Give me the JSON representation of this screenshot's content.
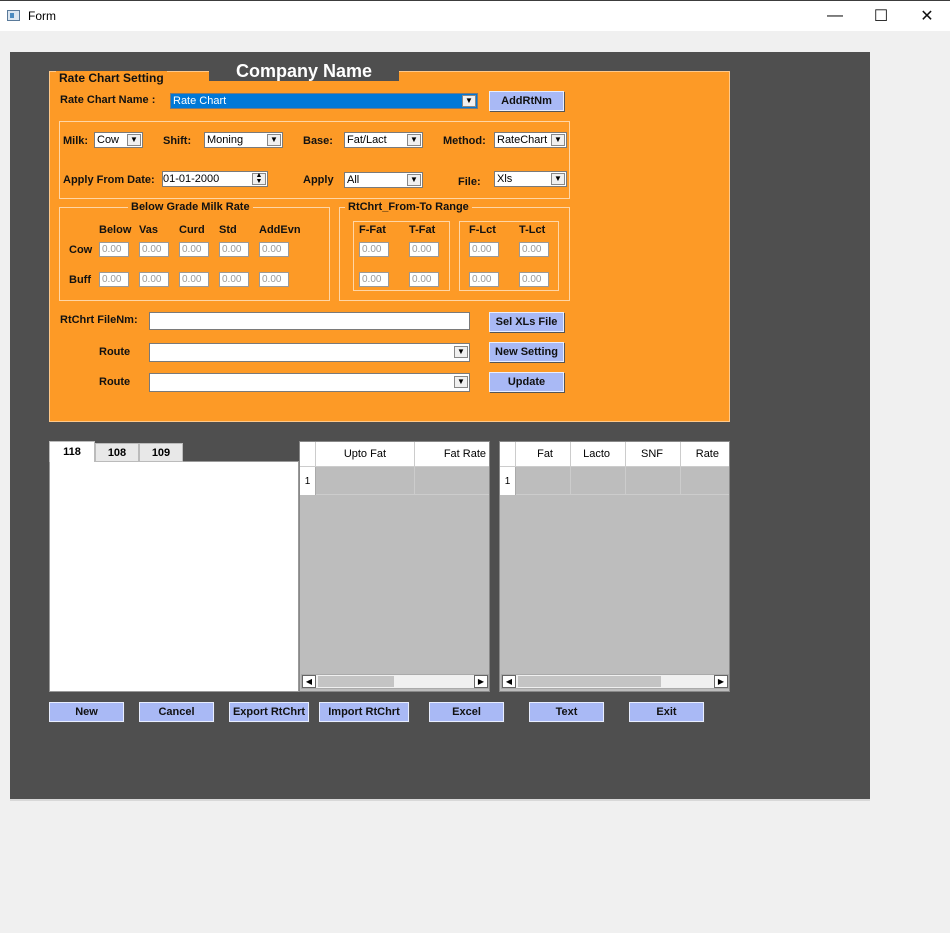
{
  "window": {
    "title": "Form",
    "minimize": "—",
    "maximize": "☐",
    "close": "✕"
  },
  "header": {
    "group_title": "Rate Chart Setting",
    "company": "Company Name"
  },
  "rate_chart": {
    "label": "Rate Chart Name :",
    "value": "Rate Chart",
    "add_button": "AddRtNm"
  },
  "fields": {
    "milk": {
      "label": "Milk:",
      "value": "Cow"
    },
    "shift": {
      "label": "Shift:",
      "value": "Moning"
    },
    "base": {
      "label": "Base:",
      "value": "Fat/Lact"
    },
    "method": {
      "label": "Method:",
      "value": "RateChart"
    },
    "apply_from": {
      "label": "Apply From Date:",
      "value": "01-01-2000"
    },
    "apply": {
      "label": "Apply",
      "value": "All"
    },
    "file": {
      "label": "File:",
      "value": "Xls"
    }
  },
  "below_grade": {
    "title": "Below Grade Milk Rate",
    "columns": [
      "Below",
      "Vas",
      "Curd",
      "Std",
      "AddEvn"
    ],
    "rows": [
      {
        "label": "Cow",
        "values": [
          "0.00",
          "0.00",
          "0.00",
          "0.00",
          "0.00"
        ]
      },
      {
        "label": "Buff",
        "values": [
          "0.00",
          "0.00",
          "0.00",
          "0.00",
          "0.00"
        ]
      }
    ]
  },
  "range": {
    "title": "RtChrt_From-To Range",
    "fat_cols": [
      "F-Fat",
      "T-Fat"
    ],
    "lct_cols": [
      "F-Lct",
      "T-Lct"
    ],
    "fat_values": [
      [
        "0.00",
        "0.00"
      ],
      [
        "0.00",
        "0.00"
      ]
    ],
    "lct_values": [
      [
        "0.00",
        "0.00"
      ],
      [
        "0.00",
        "0.00"
      ]
    ]
  },
  "file_row": {
    "label": "RtChrt FileNm:",
    "value": "",
    "button": "Sel XLs File"
  },
  "route1": {
    "label": "Route",
    "value": "",
    "button": "New Setting"
  },
  "route2": {
    "label": "Route",
    "value": "",
    "button": "Update"
  },
  "tabs": [
    "118",
    "108",
    "109"
  ],
  "grid1": {
    "columns": [
      "Upto Fat",
      "Fat Rate"
    ],
    "rows": [
      "1"
    ]
  },
  "grid2": {
    "columns": [
      "Fat",
      "Lacto",
      "SNF",
      "Rate"
    ],
    "rows": [
      "1"
    ]
  },
  "actions": [
    "New",
    "Cancel",
    "Export RtChrt",
    "Import RtChrt",
    "Excel",
    "Text",
    "Exit"
  ],
  "icons": {
    "app": "form-app-icon",
    "dropdown": "chevron-down-icon",
    "spin": "spin-updown-icon",
    "scroll_left": "arrow-left-icon",
    "scroll_right": "arrow-right-icon"
  },
  "colors": {
    "panel": "#fd9a26",
    "client": "#4f4f4f",
    "button": "#a9b9f5",
    "selection": "#0078d7"
  }
}
